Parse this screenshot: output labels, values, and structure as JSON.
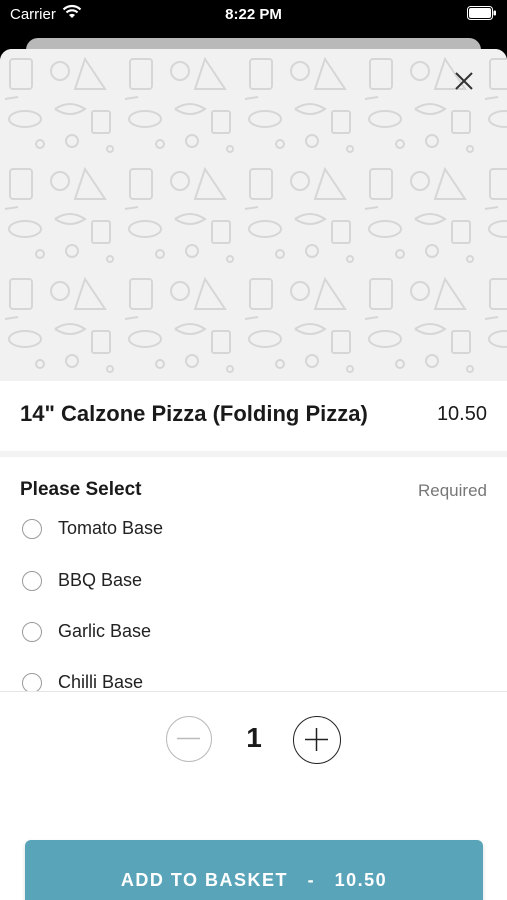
{
  "status_bar": {
    "carrier": "Carrier",
    "time": "8:22 PM",
    "icons": [
      "wifi-icon",
      "battery-icon"
    ]
  },
  "item": {
    "name": "14\" Calzone Pizza (Folding Pizza)",
    "price": "10.50"
  },
  "options": {
    "header": "Please Select",
    "required_label": "Required",
    "items": [
      {
        "label": "Tomato Base",
        "selected": false
      },
      {
        "label": "BBQ Base",
        "selected": false
      },
      {
        "label": "Garlic Base",
        "selected": false
      },
      {
        "label": "Chilli Base",
        "selected": false
      }
    ]
  },
  "quantity": {
    "value": "1",
    "minus_icon": "minus-icon",
    "plus_icon": "plus-icon"
  },
  "add_button": {
    "label": "ADD TO BASKET",
    "separator": "-",
    "price": "10.50"
  },
  "colors": {
    "accent": "#5aa4ba",
    "hero_background": "#f1f1f1"
  }
}
